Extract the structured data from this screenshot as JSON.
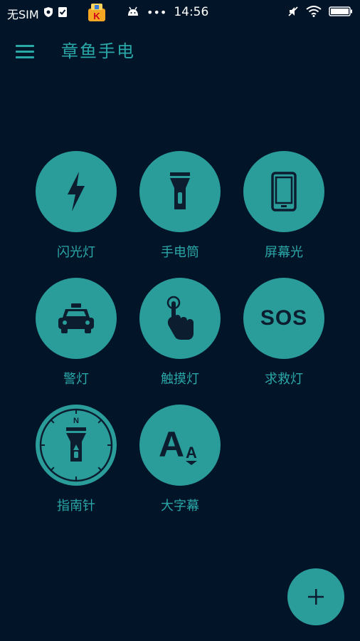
{
  "status_bar": {
    "carrier": "无SIM",
    "time": "14:56",
    "overflow": "•••",
    "icons": [
      "shield-icon",
      "check-icon",
      "android-icon",
      "mute-icon",
      "wifi-icon",
      "battery-icon"
    ]
  },
  "toolbar": {
    "title": "章鱼手电",
    "menu_icon": "hamburger-menu-icon"
  },
  "tools": [
    {
      "label": "闪光灯",
      "icon": "lightning-icon"
    },
    {
      "label": "手电筒",
      "icon": "flashlight-icon"
    },
    {
      "label": "屏幕光",
      "icon": "phone-screen-icon"
    },
    {
      "label": "警灯",
      "icon": "police-car-icon"
    },
    {
      "label": "触摸灯",
      "icon": "touch-hand-icon"
    },
    {
      "label": "求救灯",
      "icon": "sos-icon",
      "badge_text": "SOS"
    },
    {
      "label": "指南针",
      "icon": "compass-icon",
      "compass_letter": "N"
    },
    {
      "label": "大字幕",
      "icon": "text-size-icon",
      "text_big": "A",
      "text_small": "A"
    }
  ],
  "fab": {
    "label": "+",
    "icon": "plus-icon"
  },
  "colors": {
    "background": "#021428",
    "accent": "#2a9c9a",
    "accent_text": "#2aa7a7",
    "icon_dark": "#0b1d2e"
  }
}
